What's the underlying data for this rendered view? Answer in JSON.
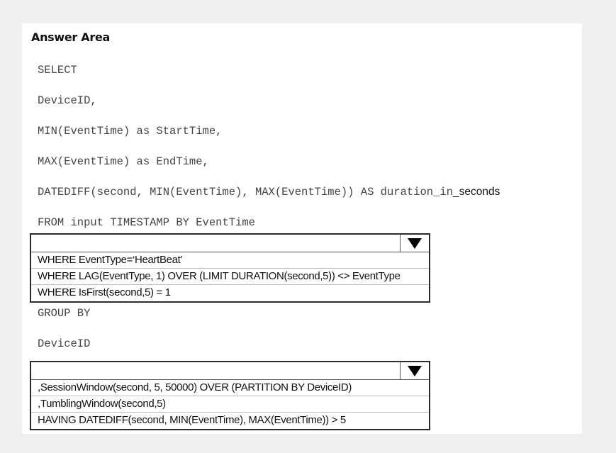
{
  "answer_area": {
    "title": "Answer Area",
    "code_lines": {
      "select": "SELECT",
      "device_id_comma": "DeviceID,",
      "min_start": "MIN(EventTime) as StartTime,",
      "max_end": "MAX(EventTime) as EndTime,",
      "datediff_prefix": "DATEDIFF(second, MIN(EventTime), MAX(EventTime)) AS duration_in",
      "datediff_suffix": "_seconds",
      "from": "FROM input TIMESTAMP BY EventTime",
      "group_by": "GROUP BY",
      "device_id": "DeviceID"
    },
    "dropdown_1": {
      "selected": "",
      "options": [
        "WHERE EventType=‘HeartBeat’",
        "WHERE LAG(EventType, 1) OVER (LIMIT DURATION(second,5)) <> EventType",
        "WHERE IsFirst(second,5) = 1"
      ]
    },
    "dropdown_2": {
      "selected": "",
      "options": [
        ",SessionWindow(second, 5, 50000) OVER (PARTITION BY DeviceID)",
        ",TumblingWindow(second,5)",
        "HAVING DATEDIFF(second, MIN(EventTime), MAX(EventTime)) > 5"
      ]
    }
  }
}
